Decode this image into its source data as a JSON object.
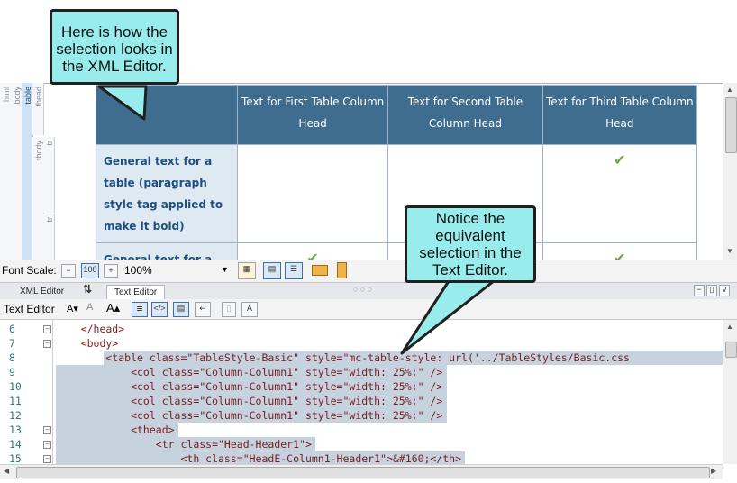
{
  "xml_editor": {
    "breadcrumbs": [
      "html",
      "body",
      "table",
      "thead",
      "tbody",
      "tr",
      "tr"
    ],
    "table": {
      "headers": [
        "",
        "Text for First Table Column Head",
        "Text for Second Table Column Head",
        "Text for Third Table Column Head"
      ],
      "rows": [
        {
          "label": "General text for a table (paragraph style tag applied to make it bold)",
          "checks": [
            false,
            false,
            true
          ]
        },
        {
          "label": "General text for a table (paragraph style tag",
          "checks": [
            true,
            false,
            true
          ]
        }
      ],
      "check_symbol": "✔"
    }
  },
  "font_scale": {
    "label": "Font Scale:",
    "minus_label": "−",
    "plus_label": "+",
    "value": "100%",
    "dropdown_icon": "chevron-down-icon"
  },
  "tabs": [
    {
      "label": "XML Editor",
      "active": false
    },
    {
      "label": "Text Editor",
      "active": true
    }
  ],
  "text_editor": {
    "label": "Text Editor",
    "lines": [
      {
        "num": "6",
        "text": "    </head>",
        "selected": false
      },
      {
        "num": "7",
        "text": "    <body>",
        "selected": false
      },
      {
        "num": "8",
        "text": "        <table class=\"TableStyle-Basic\" style=\"mc-table-style: url('../TableStyles/Basic.css",
        "selected": true
      },
      {
        "num": "9",
        "text": "            <col class=\"Column-Column1\" style=\"width: 25%;\" />",
        "selected": true
      },
      {
        "num": "10",
        "text": "            <col class=\"Column-Column1\" style=\"width: 25%;\" />",
        "selected": true
      },
      {
        "num": "11",
        "text": "            <col class=\"Column-Column1\" style=\"width: 25%;\" />",
        "selected": true
      },
      {
        "num": "12",
        "text": "            <col class=\"Column-Column1\" style=\"width: 25%;\" />",
        "selected": true
      },
      {
        "num": "13",
        "text": "            <thead>",
        "selected": true
      },
      {
        "num": "14",
        "text": "                <tr class=\"Head-Header1\">",
        "selected": true
      },
      {
        "num": "15",
        "text": "                    <th class=\"HeadE-Column1-Header1\">&#160;</th>",
        "selected": true
      }
    ]
  },
  "callouts": {
    "xml": "Here is how the selection looks in the XML Editor.",
    "text": "Notice the equivalent selection in the Text Editor."
  },
  "colors": {
    "callout_fill": "#99ecec",
    "table_head": "#3f6d8f",
    "selection": "#c6d2de",
    "tag_color": "#7a1d1d",
    "check": "#6aa846"
  }
}
